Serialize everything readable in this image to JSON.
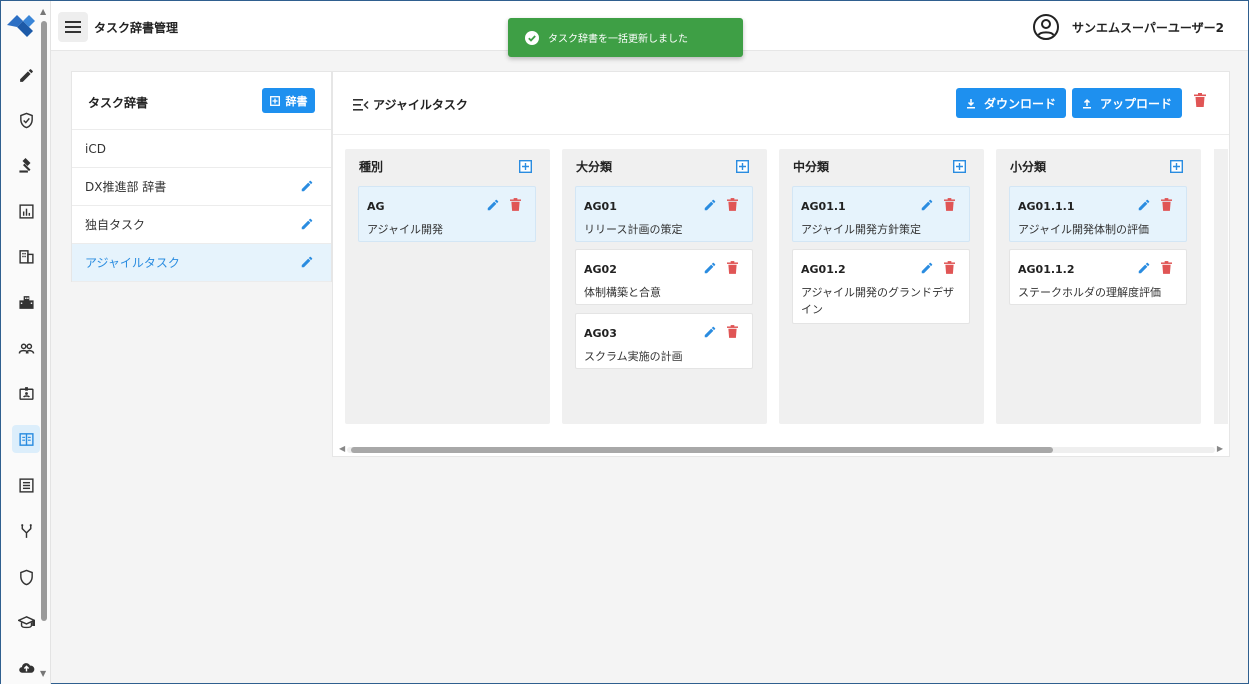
{
  "app": {
    "title": "タスク辞書管理"
  },
  "user": {
    "name": "サンエムスーパーユーザー2"
  },
  "toast": {
    "message": "タスク辞書を一括更新しました"
  },
  "colors": {
    "primary": "#1e90ef",
    "success": "#3e9f45",
    "danger": "#e05555",
    "selected_bg": "#e6f3fc"
  },
  "rail": {
    "icons": [
      "pencil-icon",
      "shield-check-icon",
      "gavel-icon",
      "bar-chart-icon",
      "building-icon",
      "buildings-icon",
      "users-icon",
      "id-card-icon",
      "dictionary-icon",
      "list-icon",
      "fork-icon",
      "shield-icon",
      "graduation-cap-icon",
      "cloud-upload-icon"
    ],
    "active": "dictionary-icon"
  },
  "dictionaries": {
    "title": "タスク辞書",
    "add_label": "辞書",
    "items": [
      {
        "label": "iCD",
        "editable": false,
        "selected": false
      },
      {
        "label": "DX推進部 辞書",
        "editable": true,
        "selected": false
      },
      {
        "label": "独自タスク",
        "editable": true,
        "selected": false
      },
      {
        "label": "アジャイルタスク",
        "editable": true,
        "selected": true
      }
    ]
  },
  "board": {
    "title": "アジャイルタスク",
    "download_label": "ダウンロード",
    "upload_label": "アップロード",
    "columns": [
      {
        "title": "種別",
        "cards": [
          {
            "code": "AG",
            "name": "アジャイル開発",
            "highlight": true
          }
        ]
      },
      {
        "title": "大分類",
        "cards": [
          {
            "code": "AG01",
            "name": "リリース計画の策定",
            "highlight": true
          },
          {
            "code": "AG02",
            "name": "体制構築と合意",
            "highlight": false
          },
          {
            "code": "AG03",
            "name": "スクラム実施の計画",
            "highlight": false
          }
        ]
      },
      {
        "title": "中分類",
        "cards": [
          {
            "code": "AG01.1",
            "name": "アジャイル開発方針策定",
            "highlight": true
          },
          {
            "code": "AG01.2",
            "name": "アジャイル開発のグランドデザイン",
            "highlight": false
          }
        ]
      },
      {
        "title": "小分類",
        "cards": [
          {
            "code": "AG01.1.1",
            "name": "アジャイル開発体制の評価",
            "highlight": true
          },
          {
            "code": "AG01.1.2",
            "name": "ステークホルダの理解度評価",
            "highlight": false
          }
        ]
      }
    ]
  }
}
